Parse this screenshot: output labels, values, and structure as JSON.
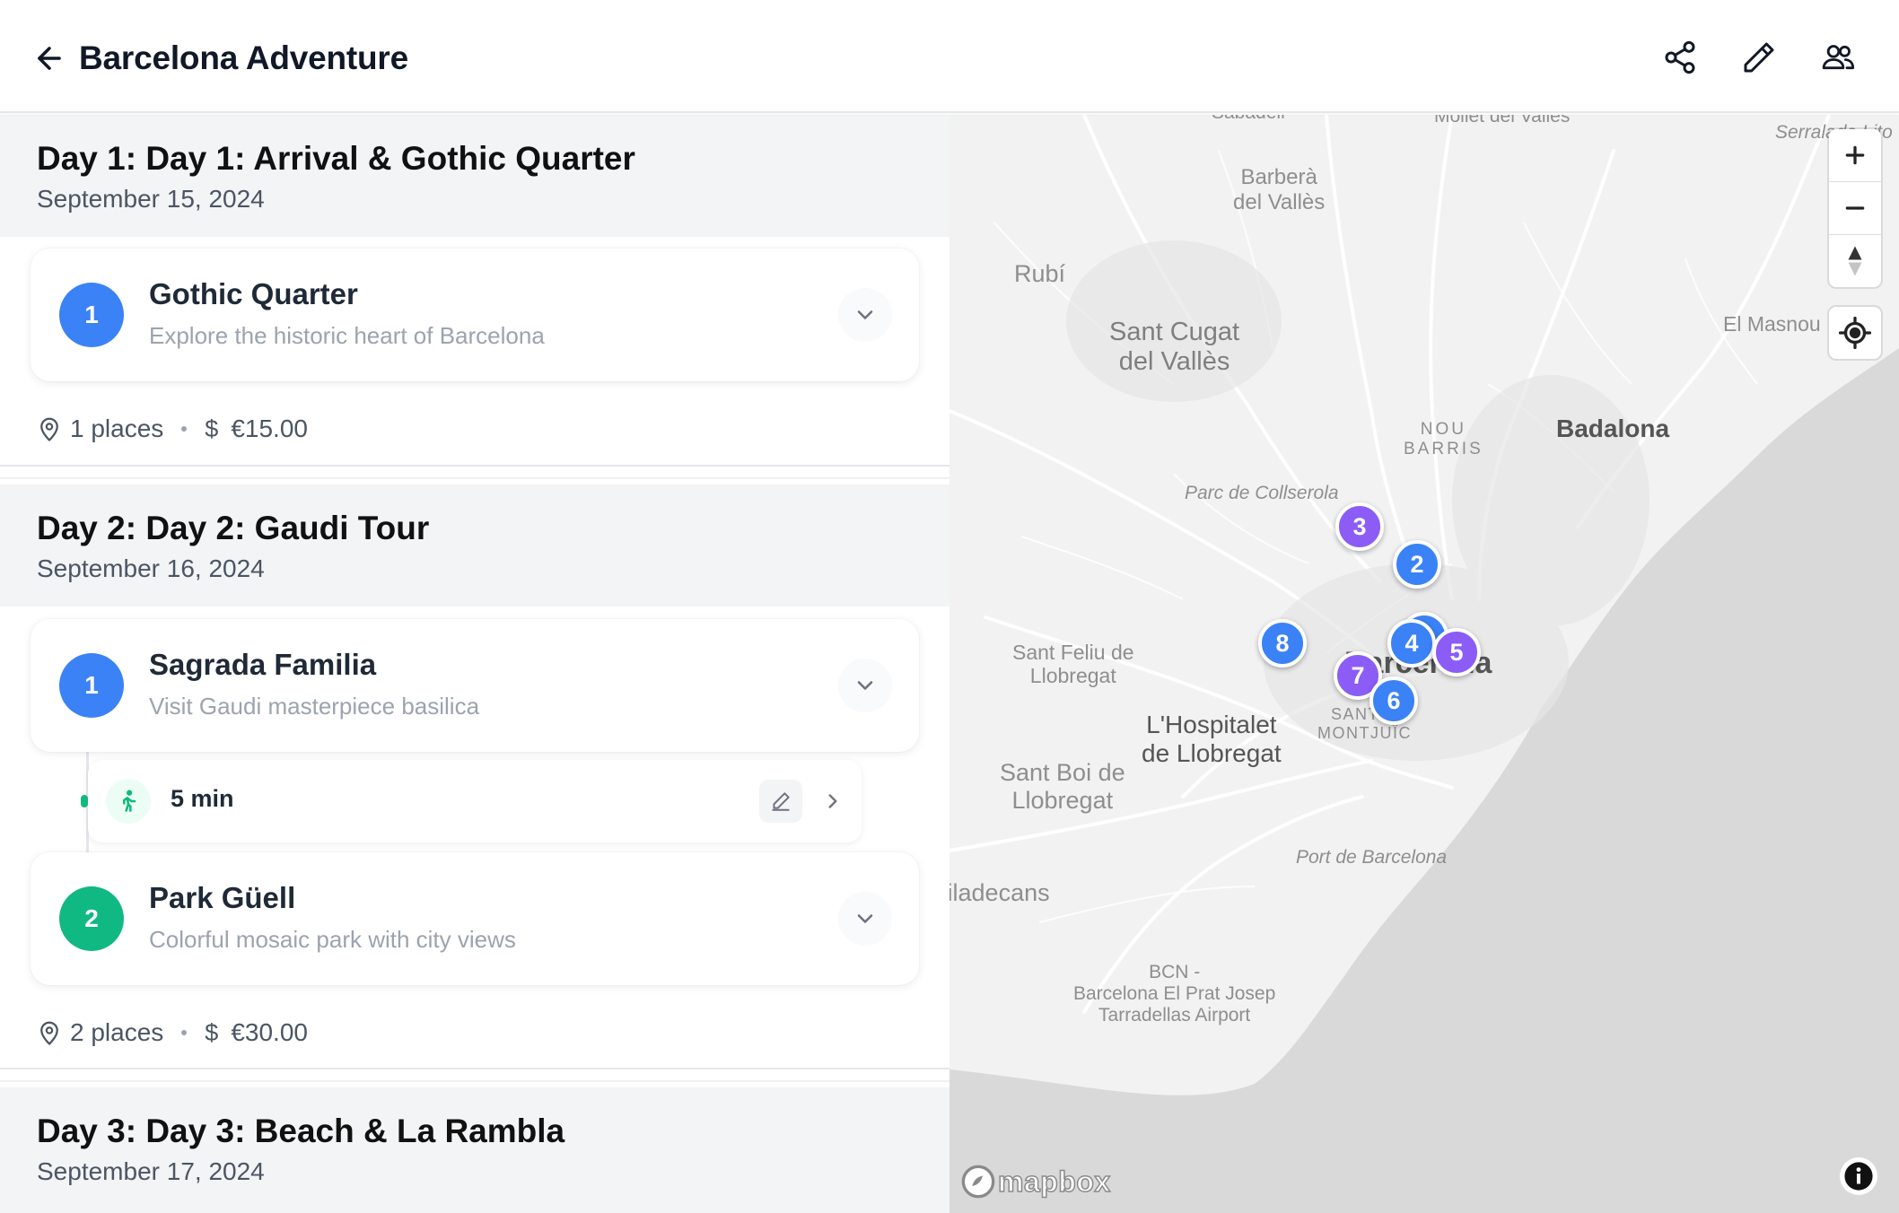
{
  "header": {
    "title": "Barcelona Adventure",
    "back_icon": "arrow-left-icon",
    "actions": [
      "share-icon",
      "edit-pencil-icon",
      "collaborators-icon"
    ]
  },
  "days": [
    {
      "title": "Day 1: Day 1: Arrival & Gothic Quarter",
      "date": "September 15, 2024",
      "places": [
        {
          "number": "1",
          "name": "Gothic Quarter",
          "description": "Explore the historic heart of Barcelona",
          "color": "#3b82f6"
        }
      ],
      "summary": {
        "places": "1 places",
        "currency_symbol": "$",
        "cost": "€15.00"
      }
    },
    {
      "title": "Day 2: Day 2: Gaudi Tour",
      "date": "September 16, 2024",
      "places": [
        {
          "number": "1",
          "name": "Sagrada Familia",
          "description": "Visit Gaudi masterpiece basilica",
          "color": "#3b82f6"
        },
        {
          "number": "2",
          "name": "Park Güell",
          "description": "Colorful mosaic park with city views",
          "color": "#10b981"
        }
      ],
      "travel": {
        "mode_icon": "walking-person-icon",
        "duration": "5 min"
      },
      "summary": {
        "places": "2 places",
        "currency_symbol": "$",
        "cost": "€30.00"
      }
    },
    {
      "title": "Day 3: Day 3: Beach & La Rambla",
      "date": "September 17, 2024"
    }
  ],
  "map": {
    "labels": {
      "sabadell": "Sabadell",
      "mollet": "Mollet del Vallès",
      "serralada": "Serralada Lito",
      "barbera": "Barberà\ndel Vallès",
      "rubi": "Rubí",
      "sant_cugat": "Sant Cugat\ndel Vallès",
      "el_masnou": "El Masnou",
      "nou_barris": "NOU\nBARRIS",
      "badalona": "Badalona",
      "collserola": "Parc de Collserola",
      "barcelona": "Barcelona",
      "sant_feliu": "Sant Feliu de\nLlobregat",
      "hospitalet": "L'Hospitalet\nde Llobregat",
      "montjuic": "SANTS-\nMONTJUÏC",
      "sant_boi": "Sant Boi de\nLlobregat",
      "port": "Port de Barcelona",
      "viladecans": "Viladecans",
      "airport": "BCN -\nBarcelona El Prat Josep\nTarradellas Airport"
    },
    "markers": [
      {
        "label": "3",
        "color": "#8b5cf6"
      },
      {
        "label": "2",
        "color": "#3b82f6"
      },
      {
        "label": "8",
        "color": "#3b82f6"
      },
      {
        "label": "",
        "color": "#3b82f6"
      },
      {
        "label": "4",
        "color": "#3b82f6"
      },
      {
        "label": "5",
        "color": "#8b5cf6"
      },
      {
        "label": "7",
        "color": "#8b5cf6"
      },
      {
        "label": "6",
        "color": "#3b82f6"
      }
    ],
    "attribution": "mapbox",
    "controls": [
      "zoom-in-icon",
      "zoom-out-icon",
      "compass-icon",
      "geolocate-icon",
      "info-icon"
    ]
  }
}
